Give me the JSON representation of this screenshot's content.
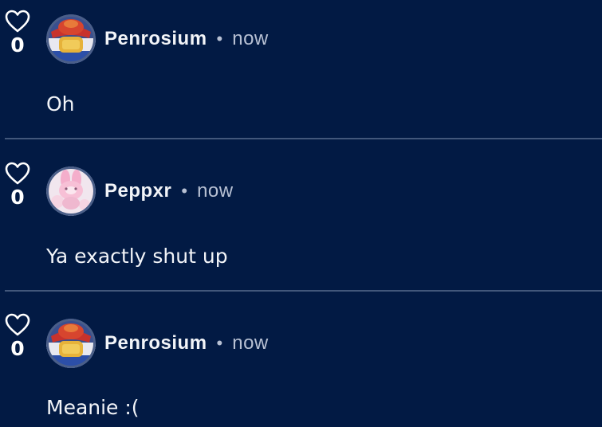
{
  "comments": [
    {
      "username": "Penrosium",
      "time": "now",
      "text": "Oh",
      "likes": "0",
      "avatar": "hamster-with-hat-avatar"
    },
    {
      "username": "Peppxr",
      "time": "now",
      "text": "Ya exactly shut up",
      "likes": "0",
      "avatar": "pink-bunny-avatar"
    },
    {
      "username": "Penrosium",
      "time": "now",
      "text": "Meanie :(",
      "likes": "0",
      "avatar": "hamster-with-hat-avatar"
    }
  ],
  "separator": "•",
  "colors": {
    "background": "#021a44",
    "divider": "#42577b",
    "text": "#f2f4f8",
    "muted": "#b7c0d3"
  }
}
